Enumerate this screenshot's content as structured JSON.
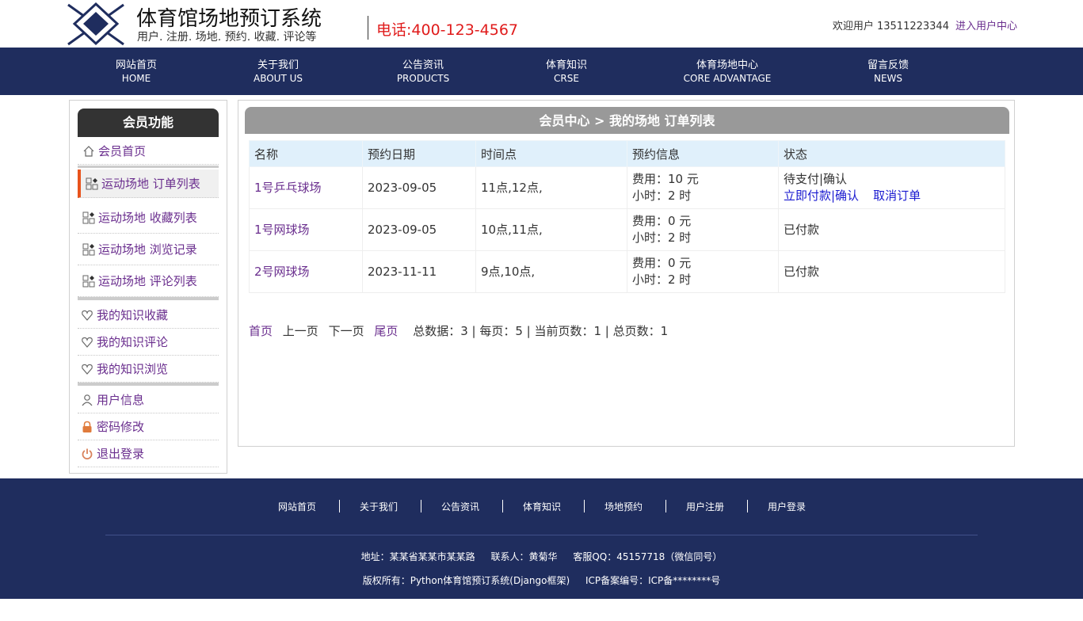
{
  "header": {
    "site_title": "体育馆场地预订系统",
    "site_subtitle": "用户. 注册. 场地. 预约. 收藏. 评论等",
    "phone": "电话:400-123-4567",
    "welcome": "欢迎用户 13511223344",
    "user_center_link": "进入用户中心"
  },
  "nav": [
    {
      "cn": "网站首页",
      "en": "HOME"
    },
    {
      "cn": "关于我们",
      "en": "ABOUT US"
    },
    {
      "cn": "公告资讯",
      "en": "PRODUCTS"
    },
    {
      "cn": "体育知识",
      "en": "CRSE"
    },
    {
      "cn": "体育场地中心",
      "en": "CORE ADVANTAGE"
    },
    {
      "cn": "留言反馈",
      "en": "NEWS"
    }
  ],
  "sidebar": {
    "title": "会员功能",
    "items": [
      {
        "label": "会员首页"
      },
      {
        "label": "运动场地 订单列表"
      },
      {
        "label": "运动场地 收藏列表"
      },
      {
        "label": "运动场地 浏览记录"
      },
      {
        "label": "运动场地 评论列表"
      },
      {
        "label": "我的知识收藏"
      },
      {
        "label": "我的知识评论"
      },
      {
        "label": "我的知识浏览"
      },
      {
        "label": "用户信息"
      },
      {
        "label": "密码修改"
      },
      {
        "label": "退出登录"
      }
    ]
  },
  "main": {
    "heading": "会员中心 > 我的场地 订单列表",
    "columns": [
      "名称",
      "预约日期",
      "时间点",
      "预约信息",
      "状态"
    ],
    "rows": [
      {
        "name": "1号乒乓球场",
        "date": "2023-09-05",
        "time": "11点,12点,",
        "fee": "费用：10 元",
        "hours": "小时：2 时",
        "status": "待支付|确认",
        "action_pay": "立即付款|确认",
        "action_cancel": "取消订单"
      },
      {
        "name": "1号网球场",
        "date": "2023-09-05",
        "time": "10点,11点,",
        "fee": "费用：0 元",
        "hours": "小时：2 时",
        "status": "已付款"
      },
      {
        "name": "2号网球场",
        "date": "2023-11-11",
        "time": "9点,10点,",
        "fee": "费用：0 元",
        "hours": "小时：2 时",
        "status": "已付款"
      }
    ],
    "pager": {
      "first": "首页",
      "prev": "上一页",
      "next": "下一页",
      "last": "尾页",
      "summary": "总数据：3 | 每页：5 | 当前页数：1 | 总页数：1"
    }
  },
  "footer": {
    "links": [
      "网站首页",
      "关于我们",
      "公告资讯",
      "体育知识",
      "场地预约",
      "用户注册",
      "用户登录"
    ],
    "address": "地址：某某省某某市某某路",
    "contact": "联系人：黄菊华",
    "qq": "客服QQ：45157718（微信同号）",
    "copyright": "版权所有：Python体育馆预订系统(Django框架)",
    "icp": "ICP备案编号：ICP备********号"
  }
}
